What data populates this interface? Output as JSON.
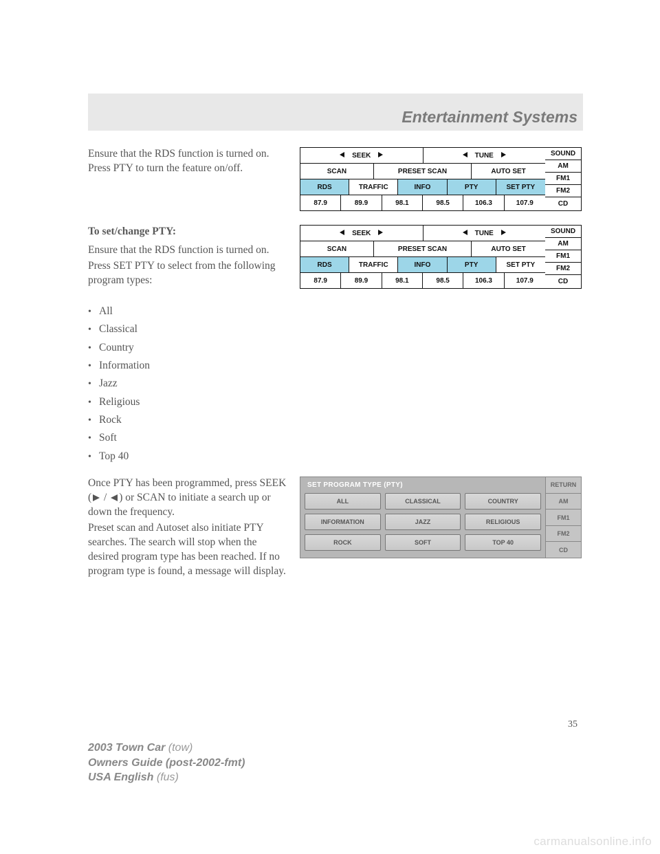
{
  "header": {
    "title": "Entertainment Systems"
  },
  "section1": {
    "text": "Ensure that the RDS function is turned on. Press PTY to turn the feature on/off."
  },
  "radio": {
    "seek": "SEEK",
    "tune": "TUNE",
    "scan": "SCAN",
    "preset_scan": "PRESET SCAN",
    "auto_set": "AUTO SET",
    "rds": "RDS",
    "traffic": "TRAFFIC",
    "info": "INFO",
    "pty": "PTY",
    "set_pty": "SET PTY",
    "presets": [
      "87.9",
      "89.9",
      "98.1",
      "98.5",
      "106.3",
      "107.9"
    ],
    "side": [
      "SOUND",
      "AM",
      "FM1",
      "FM2",
      "CD"
    ]
  },
  "section2": {
    "heading": "To set/change PTY:",
    "line1": "Ensure that the RDS function is turned on.",
    "line2": "Press SET PTY to select from the following program types:"
  },
  "pty_types": [
    "All",
    "Classical",
    "Country",
    "Information",
    "Jazz",
    "Religious",
    "Rock",
    "Soft",
    "Top 40"
  ],
  "section3": {
    "p1a": "Once PTY has been programmed, press SEEK (",
    "p1b": " / ",
    "p1c": ") or SCAN to initiate a search up or down the frequency.",
    "p2": "Preset scan and Autoset also initiate PTY searches. The search will stop when the desired program type has been reached. If no program type is found, a message will display."
  },
  "pty_panel": {
    "title": "SET PROGRAM TYPE (PTY)",
    "buttons": [
      "ALL",
      "CLASSICAL",
      "COUNTRY",
      "INFORMATION",
      "JAZZ",
      "RELIGIOUS",
      "ROCK",
      "SOFT",
      "TOP 40"
    ],
    "side": [
      "RETURN",
      "AM",
      "FM1",
      "FM2",
      "CD"
    ]
  },
  "page_number": "35",
  "footer": {
    "l1a": "2003 Town Car ",
    "l1b": "(tow)",
    "l2a": "Owners Guide (post-2002-fmt)",
    "l3a": "USA English ",
    "l3b": "(fus)"
  },
  "watermark": "carmanualsonline.info"
}
